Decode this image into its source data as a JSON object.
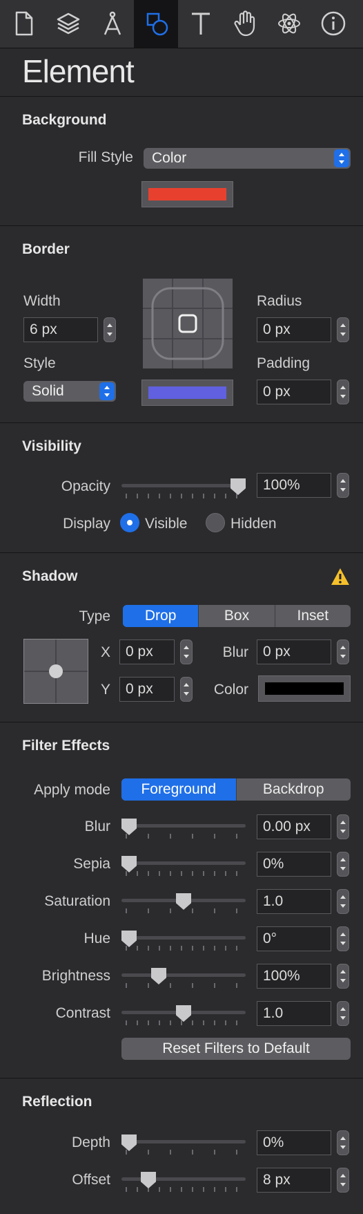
{
  "toolbar": {
    "icons": [
      "document-icon",
      "layers-icon",
      "compass-icon",
      "shapes-icon",
      "text-icon",
      "hand-icon",
      "atom-icon",
      "info-icon"
    ],
    "active": 3,
    "accent": "#1f6fe8"
  },
  "title": "Element",
  "background": {
    "heading": "Background",
    "fill_style_label": "Fill Style",
    "fill_style_value": "Color",
    "swatch_color": "#e8402f"
  },
  "border": {
    "heading": "Border",
    "width_label": "Width",
    "width_value": "6 px",
    "style_label": "Style",
    "style_value": "Solid",
    "radius_label": "Radius",
    "radius_value": "0 px",
    "padding_label": "Padding",
    "padding_value": "0 px",
    "swatch_color": "#6060e0"
  },
  "visibility": {
    "heading": "Visibility",
    "opacity_label": "Opacity",
    "opacity_value": "100%",
    "opacity_level": 1.0,
    "display_label": "Display",
    "visible_label": "Visible",
    "hidden_label": "Hidden",
    "selected": "Visible"
  },
  "shadow": {
    "heading": "Shadow",
    "type_label": "Type",
    "types": [
      "Drop",
      "Box",
      "Inset"
    ],
    "selected": "Drop",
    "x_label": "X",
    "x_value": "0 px",
    "y_label": "Y",
    "y_value": "0 px",
    "blur_label": "Blur",
    "blur_value": "0 px",
    "color_label": "Color",
    "color": "#000000",
    "warning_color": "#f5c02b"
  },
  "filters": {
    "heading": "Filter Effects",
    "apply_mode_label": "Apply mode",
    "modes": [
      "Foreground",
      "Backdrop"
    ],
    "selected": "Foreground",
    "rows": [
      {
        "label": "Blur",
        "value": "0.00 px",
        "level": 0.0
      },
      {
        "label": "Sepia",
        "value": "0%",
        "level": 0.0
      },
      {
        "label": "Saturation",
        "value": "1.0",
        "level": 0.5
      },
      {
        "label": "Hue",
        "value": "0°",
        "level": 0.0
      },
      {
        "label": "Brightness",
        "value": "100%",
        "level": 0.27
      },
      {
        "label": "Contrast",
        "value": "1.0",
        "level": 0.5
      }
    ],
    "reset_label": "Reset Filters to Default"
  },
  "reflection": {
    "heading": "Reflection",
    "rows": [
      {
        "label": "Depth",
        "value": "0%",
        "level": 0.0
      },
      {
        "label": "Offset",
        "value": "8 px",
        "level": 0.18
      }
    ]
  }
}
